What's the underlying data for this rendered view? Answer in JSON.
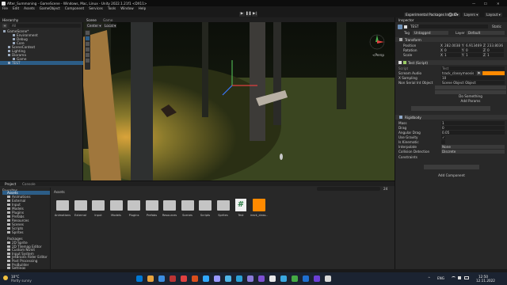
{
  "window": {
    "title": "After_Summoning - GameScene - Windows, Mac, Linux - Unity 2022.1.21f1 <DX11>",
    "controls": [
      "—",
      "☐",
      "✕"
    ]
  },
  "menu": [
    "File",
    "Edit",
    "Assets",
    "GameObject",
    "Component",
    "Services",
    "Tools",
    "Window",
    "Help"
  ],
  "toolbar": {
    "account": "Experimental Packages In Use ▾",
    "layers": "Layers ▾",
    "layout": "Layout ▾"
  },
  "hierarchy": {
    "title": "Hierarchy",
    "search_placeholder": "All",
    "items": [
      {
        "label": "GameScene*",
        "indent": 0
      },
      {
        "label": "Environment",
        "indent": 2
      },
      {
        "label": "Debug",
        "indent": 2
      },
      {
        "label": "Core",
        "indent": 2
      },
      {
        "label": "SceneContext",
        "indent": 1
      },
      {
        "label": "Lighting",
        "indent": 1
      },
      {
        "label": "Diorama",
        "indent": 1
      },
      {
        "label": "Game",
        "indent": 2
      },
      {
        "label": "TEST",
        "indent": 1,
        "selected": true
      }
    ]
  },
  "scene": {
    "tabs": [
      "Scene",
      "Game"
    ],
    "tool_center": "Center ▾",
    "tool_local": "Local ▾",
    "gizmo_label": "≺Persp"
  },
  "inspector": {
    "title": "Inspector",
    "static": "Static",
    "object_name": "TEST",
    "tag_label": "Tag",
    "tag_value": "Untagged",
    "layer_label": "Layer",
    "layer_value": "Default",
    "transform": {
      "title": "Transform",
      "rows": [
        {
          "label": "Position",
          "x": "282.0038",
          "y": "6.913469",
          "z": "233.8036"
        },
        {
          "label": "Rotation",
          "x": "0",
          "y": "0",
          "z": "0"
        },
        {
          "label": "Scale",
          "x": "1",
          "y": "1",
          "z": "1"
        }
      ]
    },
    "script": {
      "title": "Test (Script)",
      "rows": [
        {
          "label": "Script",
          "value": "Test"
        },
        {
          "label": "Scream Audio",
          "value": "track_classymoosis"
        },
        {
          "label": "X Sampling",
          "value": "10"
        },
        {
          "label": "Non Serial Int Object",
          "value": "Scene Object Object"
        }
      ],
      "buttons": [
        "Do Something",
        "Add Params"
      ],
      "add_params": "Add Params"
    },
    "rigidbody": {
      "title": "Rigidbody",
      "rows": [
        {
          "label": "Mass",
          "value": "1"
        },
        {
          "label": "Drag",
          "value": "0"
        },
        {
          "label": "Angular Drag",
          "value": "0.05"
        },
        {
          "label": "Use Gravity",
          "value": "✓"
        },
        {
          "label": "Is Kinematic",
          "value": ""
        },
        {
          "label": "Interpolate",
          "value": "None"
        },
        {
          "label": "Collision Detection",
          "value": "Discrete"
        }
      ],
      "constraints": "Constraints"
    },
    "add_component": "Add Component"
  },
  "project": {
    "tabs": [
      "Project",
      "Console"
    ],
    "favorites": "Favorites",
    "assets_root": "Assets",
    "tree": [
      "Animations",
      "External",
      "Input",
      "Models",
      "Plugins",
      "Prefabs",
      "Resources",
      "Scenes",
      "Scripts",
      "Sprites"
    ],
    "packages_root": "Packages",
    "packages": [
      "2D Sprite",
      "2D Tilemap Editor",
      "Custom NUnit",
      "Input System",
      "JetBrains Rider Editor",
      "Post Processing",
      "ProBuilder",
      "Settings"
    ],
    "breadcrumb": "Assets",
    "files": [
      {
        "label": "Animations",
        "kind": "folder"
      },
      {
        "label": "External",
        "kind": "folder"
      },
      {
        "label": "Input",
        "kind": "folder"
      },
      {
        "label": "Models",
        "kind": "folder"
      },
      {
        "label": "Plugins",
        "kind": "folder"
      },
      {
        "label": "Prefabs",
        "kind": "folder"
      },
      {
        "label": "Resources",
        "kind": "folder"
      },
      {
        "label": "Scenes",
        "kind": "folder"
      },
      {
        "label": "Scripts",
        "kind": "folder"
      },
      {
        "label": "Sprites",
        "kind": "folder"
      },
      {
        "label": "Test",
        "kind": "script"
      },
      {
        "label": "track_class...",
        "kind": "audio"
      }
    ],
    "count": "24"
  },
  "taskbar": {
    "weather_temp": "10°C",
    "weather_text": "Partly sunny",
    "lang": "ENG",
    "time": "12:50",
    "date": "12.11.2022",
    "apps": [
      "#0078d4",
      "#e8a33d",
      "#3c8de0",
      "#bc3434",
      "#e04040",
      "#d94e1c",
      "#31a8ff",
      "#9999ff",
      "#4fb5e6",
      "#2ba0d6",
      "#8a7ad9",
      "#7d4fd1",
      "#e8e8e8",
      "#3aa8e0",
      "#44aa44",
      "#1f6fd0",
      "#6b3fd6",
      "#d8d8d8"
    ]
  },
  "colors": {
    "accent": "#2c5d87",
    "script_button": "#ff8a00",
    "grass": "#4a5424",
    "selected": "#2c5d87"
  }
}
